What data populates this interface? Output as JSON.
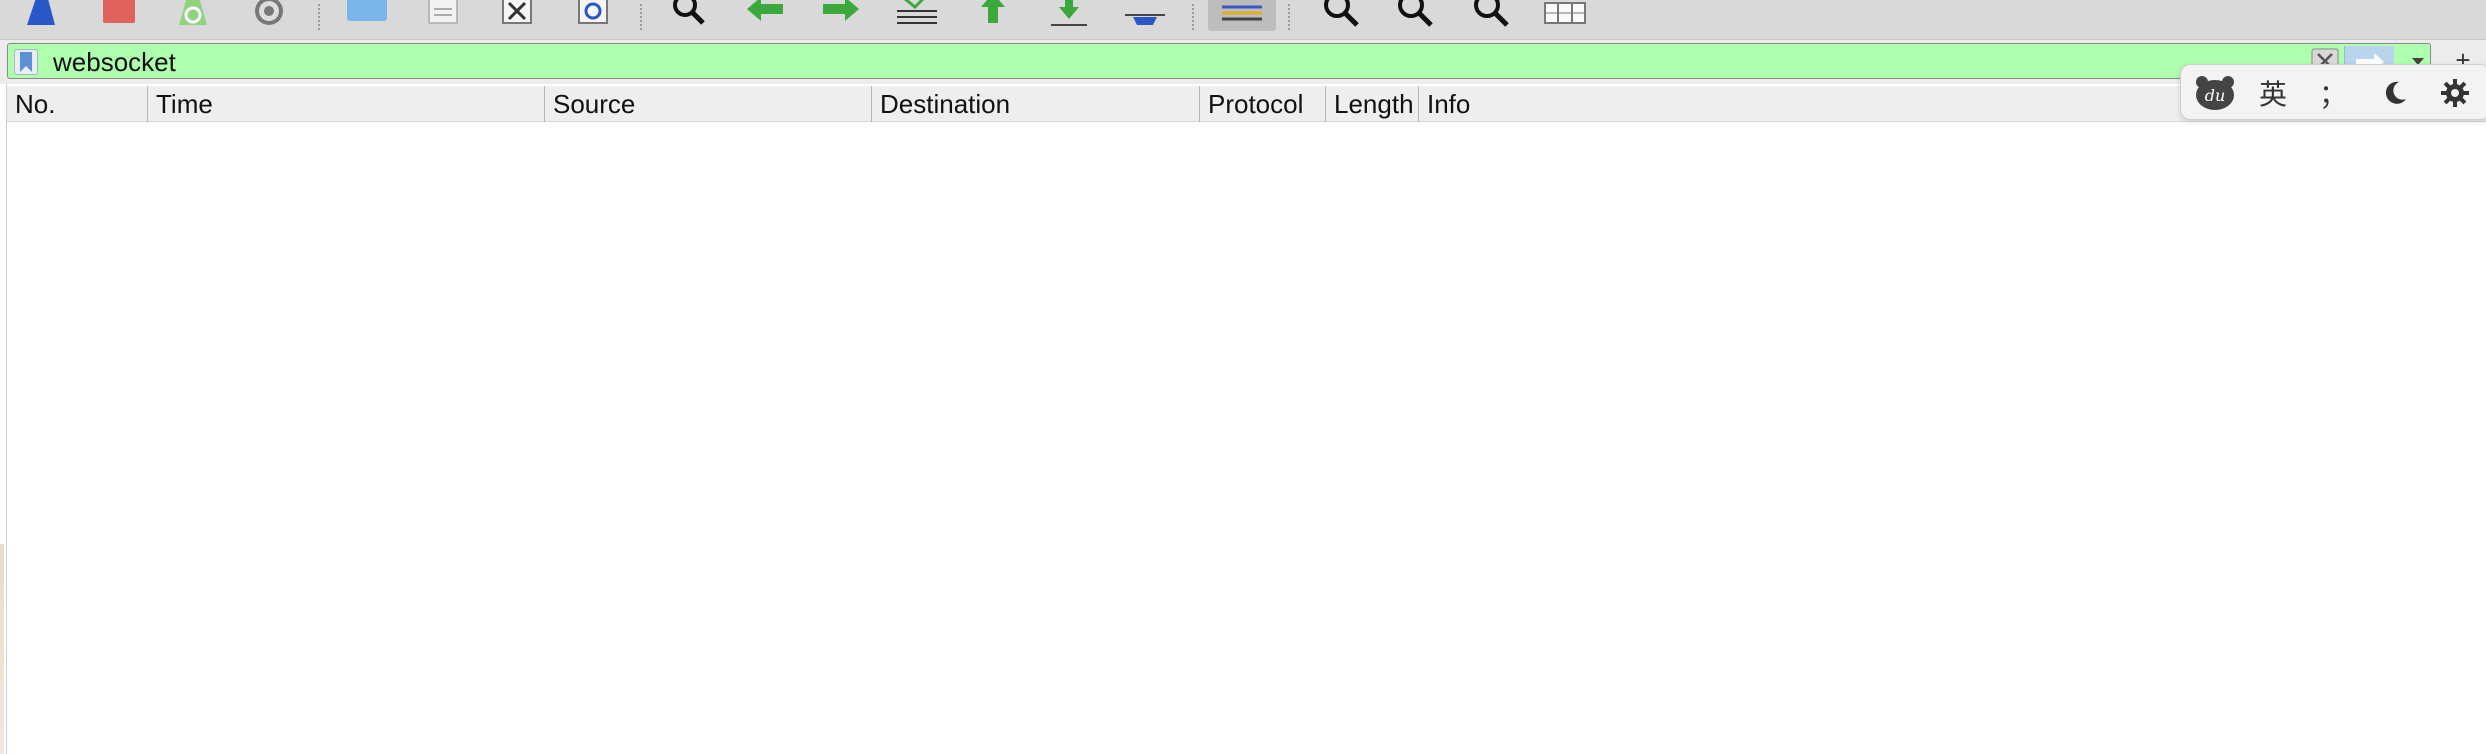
{
  "toolbar": {
    "buttons": [
      {
        "name": "start-capture-icon",
        "color": "#2a57c8"
      },
      {
        "name": "stop-capture-icon",
        "color": "#e0625c"
      },
      {
        "name": "restart-capture-icon",
        "color": "#6cbf5a"
      },
      {
        "name": "capture-options-icon",
        "color": "#555555"
      },
      {
        "name": "open-file-icon",
        "color": "#7ab6ea"
      },
      {
        "name": "save-file-icon",
        "color": "#b8b8b8"
      },
      {
        "name": "close-file-icon",
        "color": "#444444"
      },
      {
        "name": "reload-file-icon",
        "color": "#2a57c8"
      },
      {
        "name": "find-packet-icon",
        "color": "#111111"
      },
      {
        "name": "go-back-icon",
        "color": "#3aa83a"
      },
      {
        "name": "go-forward-icon",
        "color": "#3aa83a"
      },
      {
        "name": "go-to-packet-icon",
        "color": "#444444"
      },
      {
        "name": "go-first-packet-icon",
        "color": "#3aa83a"
      },
      {
        "name": "go-last-packet-icon",
        "color": "#3aa83a"
      },
      {
        "name": "auto-scroll-icon",
        "color": "#2a57c8"
      },
      {
        "name": "colorize-icon",
        "color": "#e0b020"
      },
      {
        "name": "zoom-in-icon",
        "color": "#111111"
      },
      {
        "name": "zoom-out-icon",
        "color": "#111111"
      },
      {
        "name": "normal-size-icon",
        "color": "#111111"
      },
      {
        "name": "resize-columns-icon",
        "color": "#555555"
      }
    ]
  },
  "filter": {
    "value": "websocket",
    "background": "#aeffae",
    "add_label": "+"
  },
  "columns": [
    {
      "label": "No."
    },
    {
      "label": "Time"
    },
    {
      "label": "Source"
    },
    {
      "label": "Destination"
    },
    {
      "label": "Protocol"
    },
    {
      "label": "Length"
    },
    {
      "label": "Info"
    }
  ],
  "ime": {
    "logo_text": "du",
    "lang_label": "英",
    "punct_label": "；",
    "night_icon": "moon-icon",
    "settings_icon": "gear-icon"
  }
}
